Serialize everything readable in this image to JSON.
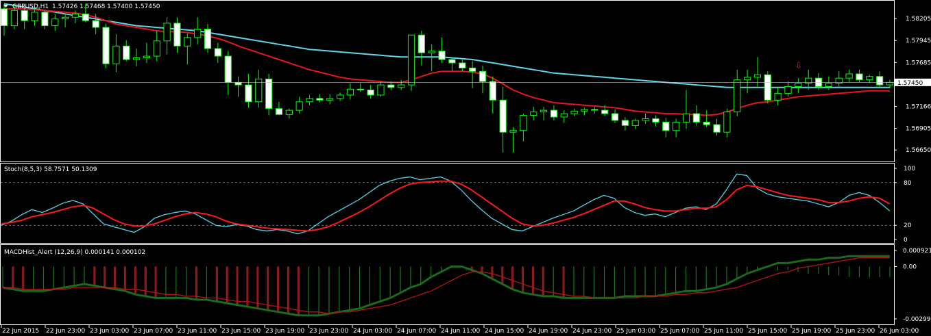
{
  "chart_data": [
    {
      "type": "candlestick",
      "title": "GBPUSD,H1",
      "ohlc_label": "1.57426 1.57468 1.57400 1.57450",
      "ylim": [
        1.5653,
        1.584
      ],
      "yticks": [
        "1.58205",
        "1.57945",
        "1.57685",
        "1.57450",
        "1.57166",
        "1.56905",
        "1.56650"
      ],
      "last_price": 1.5745,
      "last_price_label": "1.57450",
      "arrow_label": "⇩",
      "arrow_bar": 78,
      "colors": {
        "bull": "#000000",
        "bear": "#ffffff",
        "wick": "#00ff00",
        "ma_slow": "#5fd7e8",
        "ma_fast": "#e8161c",
        "grid": "#ffffff"
      },
      "candles": [
        [
          1.5832,
          1.5838,
          1.58,
          1.5812
        ],
        [
          1.5812,
          1.5838,
          1.5808,
          1.583
        ],
        [
          1.583,
          1.5834,
          1.5808,
          1.5818
        ],
        [
          1.5818,
          1.5832,
          1.5812,
          1.5828
        ],
        [
          1.5828,
          1.583,
          1.5808,
          1.5812
        ],
        [
          1.5812,
          1.5826,
          1.5806,
          1.582
        ],
        [
          1.582,
          1.5826,
          1.581,
          1.5822
        ],
        [
          1.5822,
          1.583,
          1.5815,
          1.5826
        ],
        [
          1.5826,
          1.5838,
          1.5816,
          1.5818
        ],
        [
          1.5818,
          1.5826,
          1.5802,
          1.581
        ],
        [
          1.581,
          1.5814,
          1.5762,
          1.5767
        ],
        [
          1.5767,
          1.5802,
          1.5757,
          1.5788
        ],
        [
          1.5788,
          1.5795,
          1.577,
          1.5772
        ],
        [
          1.5772,
          1.5785,
          1.5764,
          1.5774
        ],
        [
          1.5774,
          1.5792,
          1.5768,
          1.5776
        ],
        [
          1.5776,
          1.5806,
          1.577,
          1.5794
        ],
        [
          1.5794,
          1.5822,
          1.5778,
          1.5815
        ],
        [
          1.5815,
          1.5822,
          1.578,
          1.5788
        ],
        [
          1.5788,
          1.5803,
          1.5766,
          1.5798
        ],
        [
          1.5798,
          1.5822,
          1.579,
          1.5808
        ],
        [
          1.5808,
          1.5814,
          1.578,
          1.5785
        ],
        [
          1.5785,
          1.5792,
          1.5768,
          1.5776
        ],
        [
          1.5776,
          1.5782,
          1.573,
          1.5745
        ],
        [
          1.5745,
          1.5752,
          1.5728,
          1.5742
        ],
        [
          1.5742,
          1.5755,
          1.5715,
          1.5722
        ],
        [
          1.5722,
          1.576,
          1.5715,
          1.5749
        ],
        [
          1.5749,
          1.5755,
          1.5706,
          1.5714
        ],
        [
          1.5714,
          1.5722,
          1.5706,
          1.5707
        ],
        [
          1.5707,
          1.5714,
          1.5702,
          1.5712
        ],
        [
          1.5712,
          1.5728,
          1.5708,
          1.5722
        ],
        [
          1.5722,
          1.573,
          1.5718,
          1.5726
        ],
        [
          1.5726,
          1.5731,
          1.5721,
          1.5724
        ],
        [
          1.5724,
          1.5731,
          1.5719,
          1.5726
        ],
        [
          1.5726,
          1.5733,
          1.5723,
          1.573
        ],
        [
          1.573,
          1.5744,
          1.5725,
          1.5737
        ],
        [
          1.5737,
          1.5744,
          1.5734,
          1.5736
        ],
        [
          1.5736,
          1.5742,
          1.5726,
          1.573
        ],
        [
          1.573,
          1.5746,
          1.5728,
          1.5742
        ],
        [
          1.5742,
          1.5746,
          1.5736,
          1.5739
        ],
        [
          1.5739,
          1.5748,
          1.5736,
          1.5742
        ],
        [
          1.5742,
          1.5782,
          1.5735,
          1.5801
        ],
        [
          1.5801,
          1.5806,
          1.5765,
          1.578
        ],
        [
          1.578,
          1.579,
          1.5758,
          1.5782
        ],
        [
          1.5782,
          1.5798,
          1.5768,
          1.5772
        ],
        [
          1.5772,
          1.5775,
          1.5758,
          1.5768
        ],
        [
          1.5768,
          1.5772,
          1.5758,
          1.5762
        ],
        [
          1.5762,
          1.577,
          1.5738,
          1.5758
        ],
        [
          1.5758,
          1.5765,
          1.5732,
          1.5746
        ],
        [
          1.5746,
          1.5752,
          1.5708,
          1.5724
        ],
        [
          1.5724,
          1.574,
          1.5662,
          1.5686
        ],
        [
          1.5686,
          1.5692,
          1.5662,
          1.5688
        ],
        [
          1.5688,
          1.5708,
          1.5675,
          1.5706
        ],
        [
          1.5706,
          1.5716,
          1.57,
          1.571
        ],
        [
          1.571,
          1.5716,
          1.57,
          1.5712
        ],
        [
          1.5712,
          1.5718,
          1.57,
          1.5704
        ],
        [
          1.5704,
          1.5712,
          1.5697,
          1.5708
        ],
        [
          1.5708,
          1.5714,
          1.5705,
          1.5711
        ],
        [
          1.5711,
          1.5715,
          1.5706,
          1.5713
        ],
        [
          1.5713,
          1.5716,
          1.5708,
          1.5712
        ],
        [
          1.5712,
          1.5718,
          1.5705,
          1.5708
        ],
        [
          1.5708,
          1.5713,
          1.5697,
          1.57
        ],
        [
          1.57,
          1.5704,
          1.5688,
          1.5694
        ],
        [
          1.5694,
          1.5702,
          1.569,
          1.57
        ],
        [
          1.57,
          1.5708,
          1.5696,
          1.5702
        ],
        [
          1.5702,
          1.5706,
          1.5693,
          1.5698
        ],
        [
          1.5698,
          1.5703,
          1.568,
          1.5688
        ],
        [
          1.5688,
          1.5702,
          1.568,
          1.5698
        ],
        [
          1.5698,
          1.5736,
          1.569,
          1.5708
        ],
        [
          1.5708,
          1.5718,
          1.5694,
          1.5698
        ],
        [
          1.5698,
          1.5712,
          1.5692,
          1.5695
        ],
        [
          1.5695,
          1.5702,
          1.5682,
          1.5686
        ],
        [
          1.5686,
          1.5714,
          1.568,
          1.571
        ],
        [
          1.571,
          1.576,
          1.5705,
          1.5748
        ],
        [
          1.5748,
          1.576,
          1.5732,
          1.5751
        ],
        [
          1.5751,
          1.5775,
          1.574,
          1.5754
        ],
        [
          1.5754,
          1.5758,
          1.572,
          1.5724
        ],
        [
          1.5724,
          1.574,
          1.5718,
          1.5732
        ],
        [
          1.5732,
          1.5746,
          1.5728,
          1.574
        ],
        [
          1.574,
          1.575,
          1.5732,
          1.5744
        ],
        [
          1.5744,
          1.576,
          1.5736,
          1.575
        ],
        [
          1.575,
          1.5756,
          1.5736,
          1.574
        ],
        [
          1.574,
          1.5752,
          1.5736,
          1.5744
        ],
        [
          1.5744,
          1.5758,
          1.574,
          1.575
        ],
        [
          1.575,
          1.576,
          1.5745,
          1.5755
        ],
        [
          1.5755,
          1.576,
          1.5745,
          1.5748
        ],
        [
          1.5748,
          1.5754,
          1.5744,
          1.5752
        ],
        [
          1.5752,
          1.5758,
          1.5738,
          1.5742
        ],
        [
          1.5742,
          1.5748,
          1.5738,
          1.5745
        ]
      ],
      "ma_slow": [
        1.5838,
        1.5836,
        1.5834,
        1.5832,
        1.583,
        1.5828,
        1.5826,
        1.5824,
        1.5822,
        1.582,
        1.5818,
        1.5816,
        1.5814,
        1.5812,
        1.5811,
        1.581,
        1.5809,
        1.5808,
        1.5807,
        1.5806,
        1.5804,
        1.5802,
        1.58,
        1.5798,
        1.5796,
        1.5794,
        1.5792,
        1.579,
        1.5788,
        1.5786,
        1.5784,
        1.5783,
        1.5782,
        1.5781,
        1.578,
        1.5779,
        1.5778,
        1.5777,
        1.5776,
        1.5775,
        1.5775,
        1.5775,
        1.5775,
        1.5775,
        1.5774,
        1.5773,
        1.5772,
        1.577,
        1.5768,
        1.5766,
        1.5764,
        1.5762,
        1.576,
        1.5758,
        1.5756,
        1.5755,
        1.5754,
        1.5753,
        1.5752,
        1.5751,
        1.575,
        1.5749,
        1.5748,
        1.5747,
        1.5746,
        1.5745,
        1.5744,
        1.5743,
        1.5742,
        1.5741,
        1.574,
        1.5739,
        1.5739,
        1.5739,
        1.5739,
        1.5739,
        1.5739,
        1.5739,
        1.5739,
        1.5739,
        1.5739,
        1.5739,
        1.5739,
        1.5739,
        1.5739,
        1.5739,
        1.5739,
        1.5739
      ],
      "ma_fast": [
        1.5832,
        1.5832,
        1.5832,
        1.5831,
        1.583,
        1.5829,
        1.5828,
        1.5827,
        1.5825,
        1.5822,
        1.5818,
        1.5814,
        1.5812,
        1.581,
        1.5808,
        1.5806,
        1.5805,
        1.5805,
        1.5804,
        1.5802,
        1.58,
        1.5797,
        1.5793,
        1.5788,
        1.5784,
        1.578,
        1.5776,
        1.5772,
        1.5768,
        1.5764,
        1.576,
        1.5757,
        1.5754,
        1.5751,
        1.5749,
        1.5748,
        1.5747,
        1.5746,
        1.5745,
        1.5745,
        1.5748,
        1.5752,
        1.5756,
        1.5758,
        1.5758,
        1.5758,
        1.5757,
        1.5755,
        1.575,
        1.5743,
        1.5736,
        1.5731,
        1.5727,
        1.5724,
        1.5721,
        1.572,
        1.5719,
        1.5718,
        1.5717,
        1.5716,
        1.5715,
        1.5713,
        1.5711,
        1.571,
        1.5709,
        1.5708,
        1.5708,
        1.5707,
        1.5707,
        1.5706,
        1.5707,
        1.571,
        1.5714,
        1.5718,
        1.5721,
        1.5722,
        1.5724,
        1.5726,
        1.5728,
        1.5729,
        1.573,
        1.5731,
        1.5732,
        1.5733,
        1.5734,
        1.5735,
        1.5735,
        1.5735
      ]
    },
    {
      "type": "line",
      "title": "Stoch(8,5,3) 58.7571 50.1309",
      "ylim": [
        0,
        100
      ],
      "yticks": [
        "100",
        "80",
        "20",
        "0"
      ],
      "levels": [
        80,
        20
      ],
      "series": [
        {
          "values": [
            20,
            26,
            35,
            42,
            38,
            44,
            51,
            55,
            50,
            36,
            22,
            18,
            14,
            10,
            18,
            30,
            35,
            38,
            40,
            36,
            28,
            20,
            18,
            21,
            19,
            14,
            12,
            14,
            12,
            8,
            12,
            22,
            32,
            40,
            48,
            56,
            66,
            76,
            82,
            86,
            88,
            84,
            86,
            88,
            82,
            70,
            55,
            42,
            30,
            22,
            14,
            12,
            18,
            24,
            30,
            35,
            40,
            48,
            56,
            62,
            58,
            45,
            38,
            34,
            36,
            32,
            38,
            44,
            46,
            42,
            50,
            70,
            92,
            90,
            72,
            64,
            60,
            58,
            56,
            54,
            50,
            46,
            52,
            62,
            66,
            62,
            52,
            40
          ],
          "color": "#4fc9d8"
        },
        {
          "values": [
            22,
            24,
            27,
            32,
            35,
            38,
            42,
            46,
            48,
            44,
            36,
            28,
            22,
            19,
            19,
            22,
            27,
            32,
            36,
            38,
            36,
            32,
            26,
            22,
            20,
            18,
            16,
            15,
            14,
            13,
            12,
            14,
            18,
            24,
            31,
            38,
            46,
            55,
            64,
            72,
            78,
            80,
            81,
            82,
            82,
            78,
            70,
            60,
            50,
            40,
            30,
            22,
            19,
            20,
            23,
            27,
            31,
            36,
            42,
            48,
            54,
            54,
            50,
            45,
            42,
            40,
            40,
            42,
            44,
            44,
            46,
            56,
            70,
            76,
            74,
            70,
            66,
            62,
            60,
            58,
            56,
            52,
            52,
            54,
            58,
            60,
            58,
            50
          ],
          "color": "#ff1a1a"
        }
      ]
    },
    {
      "type": "bar",
      "title": "MACDHist_Alert (12,26,9) 0.000141 0.000102",
      "ylim": [
        -0.002998,
        0.000921
      ],
      "yticks": [
        "0.000921",
        "0.00",
        "-0.002998"
      ],
      "histogram": [
        -0.0012,
        -0.0013,
        -0.0014,
        -0.0014,
        -0.0014,
        -0.0013,
        -0.0012,
        -0.0011,
        -0.001,
        -0.0011,
        -0.0012,
        -0.0013,
        -0.0014,
        -0.0016,
        -0.0017,
        -0.0018,
        -0.0018,
        -0.0018,
        -0.0018,
        -0.0019,
        -0.0019,
        -0.002,
        -0.0021,
        -0.0022,
        -0.0023,
        -0.0024,
        -0.0025,
        -0.0026,
        -0.0027,
        -0.0028,
        -0.0028,
        -0.0028,
        -0.0027,
        -0.0026,
        -0.0025,
        -0.0024,
        -0.0022,
        -0.002,
        -0.0018,
        -0.0015,
        -0.0012,
        -0.001,
        -0.0006,
        -0.0003,
        -0.0,
        0.0,
        -0.0002,
        -0.0004,
        -0.0007,
        -0.001,
        -0.0013,
        -0.0015,
        -0.0016,
        -0.0017,
        -0.0017,
        -0.0018,
        -0.0018,
        -0.0018,
        -0.0018,
        -0.0018,
        -0.0018,
        -0.0017,
        -0.0017,
        -0.0017,
        -0.0017,
        -0.0016,
        -0.0015,
        -0.0014,
        -0.0014,
        -0.0013,
        -0.0012,
        -0.001,
        -0.0007,
        -0.0004,
        -0.0002,
        0.0,
        0.0002,
        0.0002,
        0.0003,
        0.0004,
        0.0004,
        0.0005,
        0.0005,
        0.0006,
        0.0006,
        0.0006,
        0.0006,
        0.0006
      ],
      "signal": [
        -0.0012,
        -0.0012,
        -0.0013,
        -0.0013,
        -0.0013,
        -0.0013,
        -0.0013,
        -0.0012,
        -0.0012,
        -0.0012,
        -0.0012,
        -0.0012,
        -0.0013,
        -0.0013,
        -0.0014,
        -0.0015,
        -0.0016,
        -0.0016,
        -0.0017,
        -0.0017,
        -0.0018,
        -0.0018,
        -0.0019,
        -0.002,
        -0.002,
        -0.0021,
        -0.0022,
        -0.0023,
        -0.0024,
        -0.0025,
        -0.0026,
        -0.0026,
        -0.0027,
        -0.0026,
        -0.0026,
        -0.0025,
        -0.0024,
        -0.0023,
        -0.0022,
        -0.002,
        -0.0018,
        -0.0016,
        -0.0014,
        -0.0011,
        -0.0008,
        -0.0005,
        -0.0003,
        -0.0003,
        -0.0004,
        -0.0006,
        -0.0008,
        -0.001,
        -0.0012,
        -0.0014,
        -0.0015,
        -0.0016,
        -0.0017,
        -0.0017,
        -0.0018,
        -0.0018,
        -0.0018,
        -0.0018,
        -0.0018,
        -0.0017,
        -0.0017,
        -0.0017,
        -0.0016,
        -0.0016,
        -0.0015,
        -0.0015,
        -0.0014,
        -0.0013,
        -0.0012,
        -0.001,
        -0.0008,
        -0.0006,
        -0.0004,
        -0.0003,
        -0.0001,
        0.0,
        0.0001,
        0.0002,
        0.0003,
        0.0004,
        0.0005,
        0.0005,
        0.0005,
        0.0005
      ],
      "colors": {
        "pos": "#1a7a1a",
        "neg": "#8b1a1a",
        "macd": "#1c6b1c",
        "signal": "#b41414"
      }
    }
  ],
  "x_axis": {
    "labels": [
      "22 Jun 2015",
      "22 Jun 23:00",
      "23 Jun 03:00",
      "23 Jun 07:00",
      "23 Jun 11:00",
      "23 Jun 15:00",
      "23 Jun 19:00",
      "23 Jun 23:00",
      "24 Jun 03:00",
      "24 Jun 07:00",
      "24 Jun 11:00",
      "24 Jun 15:00",
      "24 Jun 19:00",
      "24 Jun 23:00",
      "25 Jun 03:00",
      "25 Jun 07:00",
      "25 Jun 11:00",
      "25 Jun 15:00",
      "25 Jun 19:00",
      "25 Jun 23:00",
      "26 Jun 03:00"
    ]
  }
}
